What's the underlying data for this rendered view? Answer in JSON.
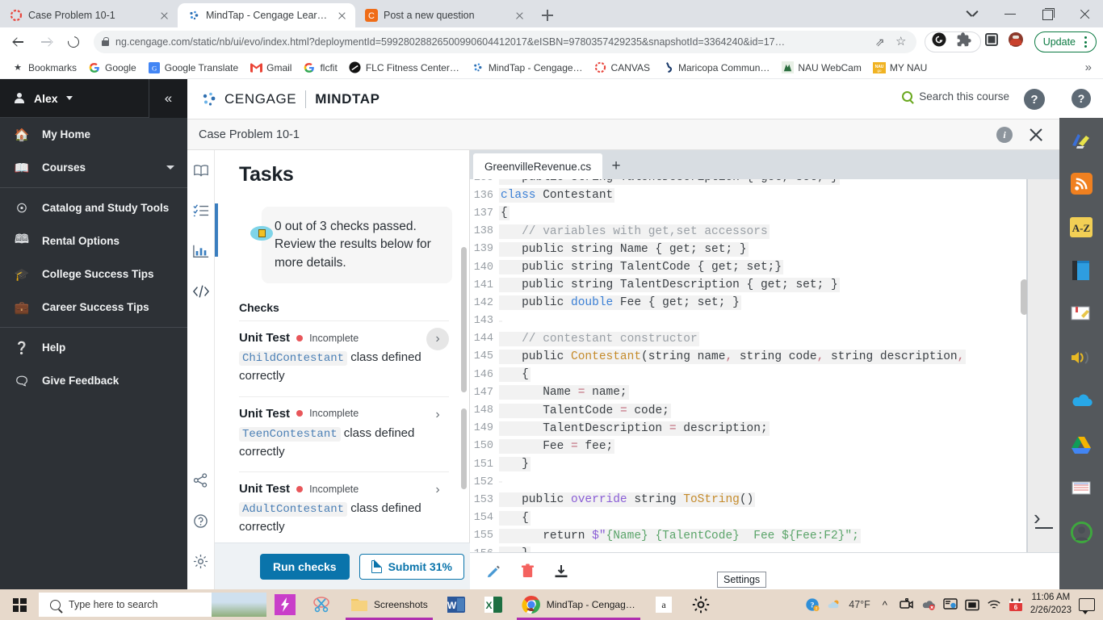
{
  "browser": {
    "tabs": [
      {
        "title": "Case Problem 10-1",
        "favicon": "cengage-icon",
        "active": false
      },
      {
        "title": "MindTap - Cengage Learning",
        "favicon": "cengage-icon",
        "active": true
      },
      {
        "title": "Post a new question",
        "favicon": "chegg-icon",
        "active": false
      }
    ],
    "new_tab_label": "+",
    "url": "ng.cengage.com/static/nb/ui/evo/index.html?deploymentId=59928028826500990604412017&eISBN=9780357429235&snapshotId=3364240&id=17…",
    "url_domain": "ng.cengage.com",
    "update_label": "Update",
    "bookmarks": [
      {
        "label": "Bookmarks",
        "icon": "star-icon"
      },
      {
        "label": "Google",
        "icon": "google-icon"
      },
      {
        "label": "Google Translate",
        "icon": "translate-icon"
      },
      {
        "label": "Gmail",
        "icon": "gmail-icon"
      },
      {
        "label": "flcfit",
        "icon": "google-icon"
      },
      {
        "label": "FLC Fitness Center -…",
        "icon": "flc-icon"
      },
      {
        "label": "MindTap - Cengage…",
        "icon": "cengage-icon"
      },
      {
        "label": "CANVAS",
        "icon": "canvas-icon"
      },
      {
        "label": "Maricopa Commun…",
        "icon": "maricopa-icon"
      },
      {
        "label": "NAU WebCam",
        "icon": "nau-icon"
      },
      {
        "label": "MY NAU",
        "icon": "mynau-icon"
      }
    ],
    "bookmarks_overflow": "»"
  },
  "left_nav": {
    "user": "Alex",
    "collapse_label": "«",
    "items": [
      {
        "label": "My Home",
        "icon": "home-icon",
        "chevron": false
      },
      {
        "label": "Courses",
        "icon": "book-icon",
        "chevron": true
      },
      {
        "label": "Catalog and Study Tools",
        "icon": "compass-icon",
        "chevron": false
      },
      {
        "label": "Rental Options",
        "icon": "openbook-icon",
        "chevron": false
      },
      {
        "label": "College Success Tips",
        "icon": "graduation-cap-icon",
        "chevron": false
      },
      {
        "label": "Career Success Tips",
        "icon": "briefcase-icon",
        "chevron": false
      },
      {
        "label": "Help",
        "icon": "question-circle-icon",
        "chevron": false
      },
      {
        "label": "Give Feedback",
        "icon": "feedback-icon",
        "chevron": false
      }
    ]
  },
  "app_header": {
    "brand_1": "CENGAGE",
    "brand_2": "MINDTAP",
    "search_label": "Search this course",
    "help_label": "?"
  },
  "sub_header": {
    "breadcrumb": "Case Problem 10-1",
    "info_label": "i"
  },
  "tool_rail": [
    {
      "icon": "ebook-icon"
    },
    {
      "icon": "checklist-icon"
    },
    {
      "icon": "chart-icon"
    },
    {
      "icon": "code-icon"
    },
    {
      "icon": "share-icon"
    },
    {
      "icon": "help-icon"
    },
    {
      "icon": "settings-icon"
    }
  ],
  "tasks": {
    "title": "Tasks",
    "banner": "0 out of 3 checks passed. Review the results below for more details.",
    "checks_heading": "Checks",
    "checks": [
      {
        "name": "Unit Test",
        "status": "Incomplete",
        "code": "ChildContestant",
        "suffix": " class defined correctly"
      },
      {
        "name": "Unit Test",
        "status": "Incomplete",
        "code": "TeenContestant",
        "suffix": " class defined correctly"
      },
      {
        "name": "Unit Test",
        "status": "Incomplete",
        "code": "AdultContestant",
        "suffix": " class defined correctly"
      }
    ],
    "run_checks_label": "Run checks",
    "submit_label": "Submit 31%"
  },
  "editor": {
    "file_tab": "GreenvilleRevenue.cs",
    "new_tab_label": "+",
    "tooltip": "Settings",
    "toolbar_icons": [
      {
        "icon": "pencil-icon"
      },
      {
        "icon": "trash-icon"
      },
      {
        "icon": "download-icon"
      }
    ],
    "lines": [
      {
        "n": "135",
        "segments": [
          {
            "t": "   public string TalentDescription { get; set; }",
            "c": ""
          }
        ]
      },
      {
        "n": "136",
        "segments": [
          {
            "t": "class",
            "c": "kw"
          },
          {
            "t": " Contestant",
            "c": ""
          }
        ]
      },
      {
        "n": "137",
        "segments": [
          {
            "t": "{",
            "c": ""
          }
        ]
      },
      {
        "n": "138",
        "segments": [
          {
            "t": "   // variables with get,set accessors",
            "c": "cmt"
          }
        ]
      },
      {
        "n": "139",
        "segments": [
          {
            "t": "   public string Name { get; set; }",
            "c": ""
          }
        ]
      },
      {
        "n": "140",
        "segments": [
          {
            "t": "   public string TalentCode { get; set;}",
            "c": ""
          }
        ]
      },
      {
        "n": "141",
        "segments": [
          {
            "t": "   public string TalentDescription { get; set; }",
            "c": ""
          }
        ]
      },
      {
        "n": "142",
        "segments": [
          {
            "t": "   public ",
            "c": ""
          },
          {
            "t": "double",
            "c": "kw"
          },
          {
            "t": " Fee { get; set; }",
            "c": ""
          }
        ]
      },
      {
        "n": "143",
        "segments": [
          {
            "t": "",
            "c": ""
          }
        ]
      },
      {
        "n": "144",
        "segments": [
          {
            "t": "   // contestant constructor",
            "c": "cmt"
          }
        ]
      },
      {
        "n": "145",
        "segments": [
          {
            "t": "   public ",
            "c": ""
          },
          {
            "t": "Contestant",
            "c": "type"
          },
          {
            "t": "(string name",
            "c": ""
          },
          {
            "t": ",",
            "c": "punct"
          },
          {
            "t": " string code",
            "c": ""
          },
          {
            "t": ",",
            "c": "punct"
          },
          {
            "t": " string description",
            "c": ""
          },
          {
            "t": ",",
            "c": "punct"
          }
        ]
      },
      {
        "n": "146",
        "segments": [
          {
            "t": "   {",
            "c": ""
          }
        ]
      },
      {
        "n": "147",
        "segments": [
          {
            "t": "      Name ",
            "c": ""
          },
          {
            "t": "=",
            "c": "punct"
          },
          {
            "t": " name;",
            "c": ""
          }
        ]
      },
      {
        "n": "148",
        "segments": [
          {
            "t": "      TalentCode ",
            "c": ""
          },
          {
            "t": "=",
            "c": "punct"
          },
          {
            "t": " code;",
            "c": ""
          }
        ]
      },
      {
        "n": "149",
        "segments": [
          {
            "t": "      TalentDescription ",
            "c": ""
          },
          {
            "t": "=",
            "c": "punct"
          },
          {
            "t": " description;",
            "c": ""
          }
        ]
      },
      {
        "n": "150",
        "segments": [
          {
            "t": "      Fee ",
            "c": ""
          },
          {
            "t": "=",
            "c": "punct"
          },
          {
            "t": " fee;",
            "c": ""
          }
        ]
      },
      {
        "n": "151",
        "segments": [
          {
            "t": "   }",
            "c": ""
          }
        ]
      },
      {
        "n": "152",
        "segments": [
          {
            "t": "",
            "c": ""
          }
        ]
      },
      {
        "n": "153",
        "segments": [
          {
            "t": "   public ",
            "c": ""
          },
          {
            "t": "override",
            "c": "mod"
          },
          {
            "t": " string ",
            "c": ""
          },
          {
            "t": "ToString",
            "c": "type"
          },
          {
            "t": "()",
            "c": ""
          }
        ]
      },
      {
        "n": "154",
        "segments": [
          {
            "t": "   {",
            "c": ""
          }
        ]
      },
      {
        "n": "155",
        "segments": [
          {
            "t": "      return ",
            "c": ""
          },
          {
            "t": "$\"",
            "c": "mod"
          },
          {
            "t": "{Name} {TalentCode}  Fee ${Fee:F2}\";",
            "c": "str"
          }
        ]
      },
      {
        "n": "156",
        "segments": [
          {
            "t": "   }",
            "c": ""
          }
        ]
      }
    ]
  },
  "right_rail": {
    "help_label": "?",
    "items": [
      {
        "icon": "highlighter-icon"
      },
      {
        "icon": "rss-icon"
      },
      {
        "icon": "az-dictionary-icon"
      },
      {
        "icon": "book-icon"
      },
      {
        "icon": "bookmark-highlight-icon"
      },
      {
        "icon": "read-aloud-icon"
      },
      {
        "icon": "onedrive-icon"
      },
      {
        "icon": "google-drive-icon"
      },
      {
        "icon": "notecards-icon"
      },
      {
        "icon": "profile-icon"
      }
    ]
  },
  "taskbar": {
    "search_placeholder": "Type here to search",
    "apps": [
      {
        "label": "",
        "icon": "flipgrid-icon"
      },
      {
        "label": "",
        "icon": "snip-sketch-icon"
      },
      {
        "label": "Screenshots",
        "icon": "folder-icon"
      },
      {
        "label": "",
        "icon": "word-icon"
      },
      {
        "label": "",
        "icon": "excel-icon"
      },
      {
        "label": "MindTap - Cengag…",
        "icon": "chrome-icon"
      },
      {
        "label": "",
        "icon": "amazon-icon"
      },
      {
        "label": "",
        "icon": "settings-gear-icon"
      }
    ],
    "tray": [
      {
        "icon": "help-blue-icon"
      },
      {
        "icon": "weather-icon"
      }
    ],
    "temperature": "47°F",
    "time": "11:06 AM",
    "date": "2/26/2023"
  }
}
